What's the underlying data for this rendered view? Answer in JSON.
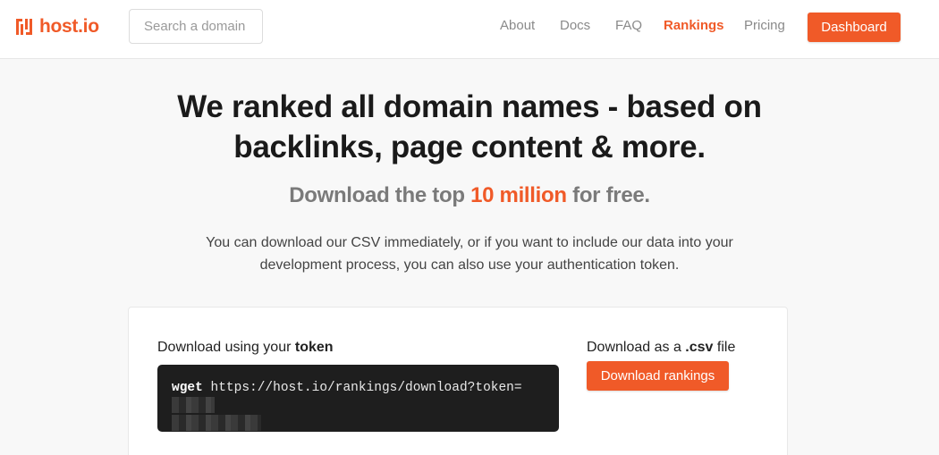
{
  "header": {
    "logo_text": "host.io",
    "search_placeholder": "Search a domain",
    "nav": [
      {
        "label": "About"
      },
      {
        "label": "Docs"
      },
      {
        "label": "FAQ"
      },
      {
        "label": "Rankings",
        "active": true
      },
      {
        "label": "Pricing"
      }
    ],
    "dashboard_label": "Dashboard"
  },
  "hero": {
    "headline": "We ranked all domain names - based on backlinks, page content & more.",
    "subhead_pre": "Download the top ",
    "subhead_highlight": "10 million",
    "subhead_post": " for free.",
    "description": "You can download our CSV immediately, or if you want to include our data into your development process, you can also use your authentication token."
  },
  "download": {
    "token_label_pre": "Download using your ",
    "token_label_bold": "token",
    "command_keyword": "wget",
    "command_url": "https://host.io/rankings/download?token=",
    "csv_label_pre": "Download as a ",
    "csv_label_bold": ".csv",
    "csv_label_post": " file",
    "button_label": "Download rankings"
  },
  "colors": {
    "accent": "#f05a28",
    "background": "#f8f8f8",
    "code_bg": "#1e1e1e"
  }
}
